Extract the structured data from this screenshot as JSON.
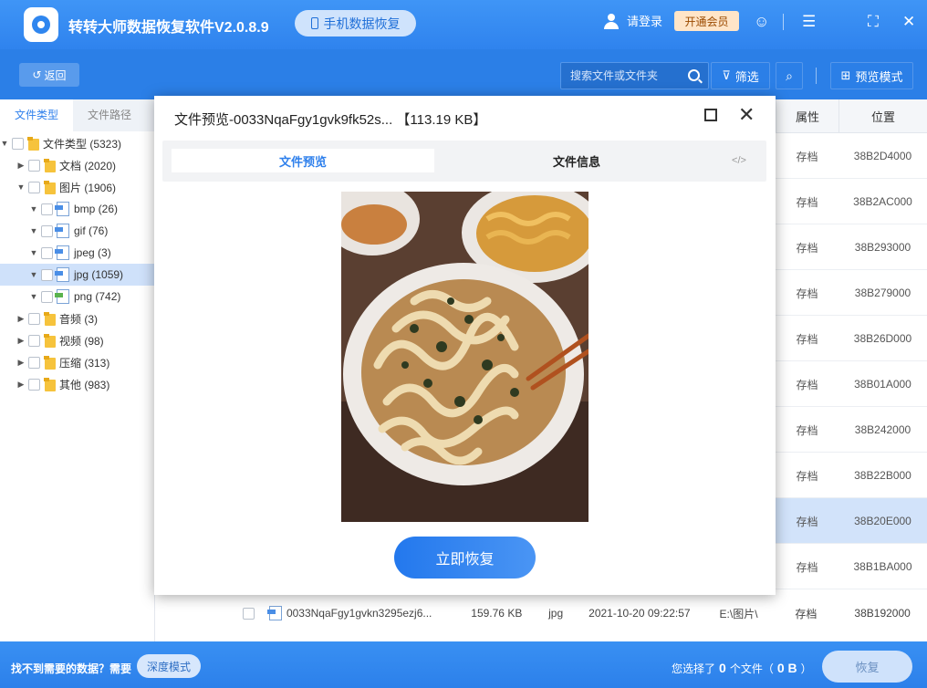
{
  "app": {
    "title": "转转大师数据恢复软件V2.0.8.9",
    "mobile_recovery_label": "手机数据恢复",
    "login_label": "请登录",
    "vip_label": "开通会员"
  },
  "toolbar": {
    "back_label": "返回",
    "search_placeholder": "搜索文件或文件夹",
    "filter_label": "筛选",
    "preview_mode_label": "预览模式"
  },
  "sidebar": {
    "tabs": [
      "文件类型",
      "文件路径"
    ],
    "tree": [
      {
        "label": "文件类型 (5323)",
        "level": 0,
        "expanded": true
      },
      {
        "label": "文档 (2020)",
        "level": 1,
        "expanded": false
      },
      {
        "label": "图片 (1906)",
        "level": 1,
        "expanded": true
      },
      {
        "label": "bmp (26)",
        "level": 2
      },
      {
        "label": "gif (76)",
        "level": 2
      },
      {
        "label": "jpeg (3)",
        "level": 2
      },
      {
        "label": "jpg (1059)",
        "level": 2,
        "selected": true
      },
      {
        "label": "png (742)",
        "level": 2
      },
      {
        "label": "音频 (3)",
        "level": 1,
        "expanded": false
      },
      {
        "label": "视频 (98)",
        "level": 1,
        "expanded": false
      },
      {
        "label": "压缩 (313)",
        "level": 1,
        "expanded": false
      },
      {
        "label": "其他 (983)",
        "level": 1,
        "expanded": false
      }
    ]
  },
  "table": {
    "headers": {
      "attr": "属性",
      "location": "位置"
    },
    "rows": [
      {
        "attr": "存档",
        "location": "38B2D4000"
      },
      {
        "attr": "存档",
        "location": "38B2AC000"
      },
      {
        "attr": "存档",
        "location": "38B293000"
      },
      {
        "attr": "存档",
        "location": "38B279000"
      },
      {
        "attr": "存档",
        "location": "38B26D000"
      },
      {
        "attr": "存档",
        "location": "38B01A000"
      },
      {
        "attr": "存档",
        "location": "38B242000"
      },
      {
        "attr": "存档",
        "location": "38B22B000"
      },
      {
        "attr": "存档",
        "location": "38B20E000",
        "highlighted": true
      },
      {
        "attr": "存档",
        "location": "38B1BA000"
      }
    ],
    "full_row": {
      "name": "0033NqaFgy1gvkn3295ezj6...",
      "size": "159.76 KB",
      "type": "jpg",
      "date": "2021-10-20 09:22:57",
      "path": "E:\\图片\\",
      "attr": "存档",
      "location": "38B192000"
    }
  },
  "modal": {
    "title": "文件预览-0033NqaFgy1gvk9fk52s... 【113.19 KB】",
    "tabs": {
      "preview": "文件预览",
      "info": "文件信息",
      "code": "</>"
    },
    "restore_label": "立即恢复"
  },
  "bottom": {
    "not_found_text": "找不到需要的数据？需要",
    "deep_mode_label": "深度模式",
    "selected_prefix": "您选择了",
    "selected_count": "0",
    "selected_mid": "个文件（",
    "selected_size": "0 B",
    "selected_suffix": "）",
    "recover_label": "恢复"
  },
  "colors": {
    "brand_blue": "#2f83ee",
    "accent_blue": "#2f80ec",
    "selection": "#cfe1fa"
  }
}
